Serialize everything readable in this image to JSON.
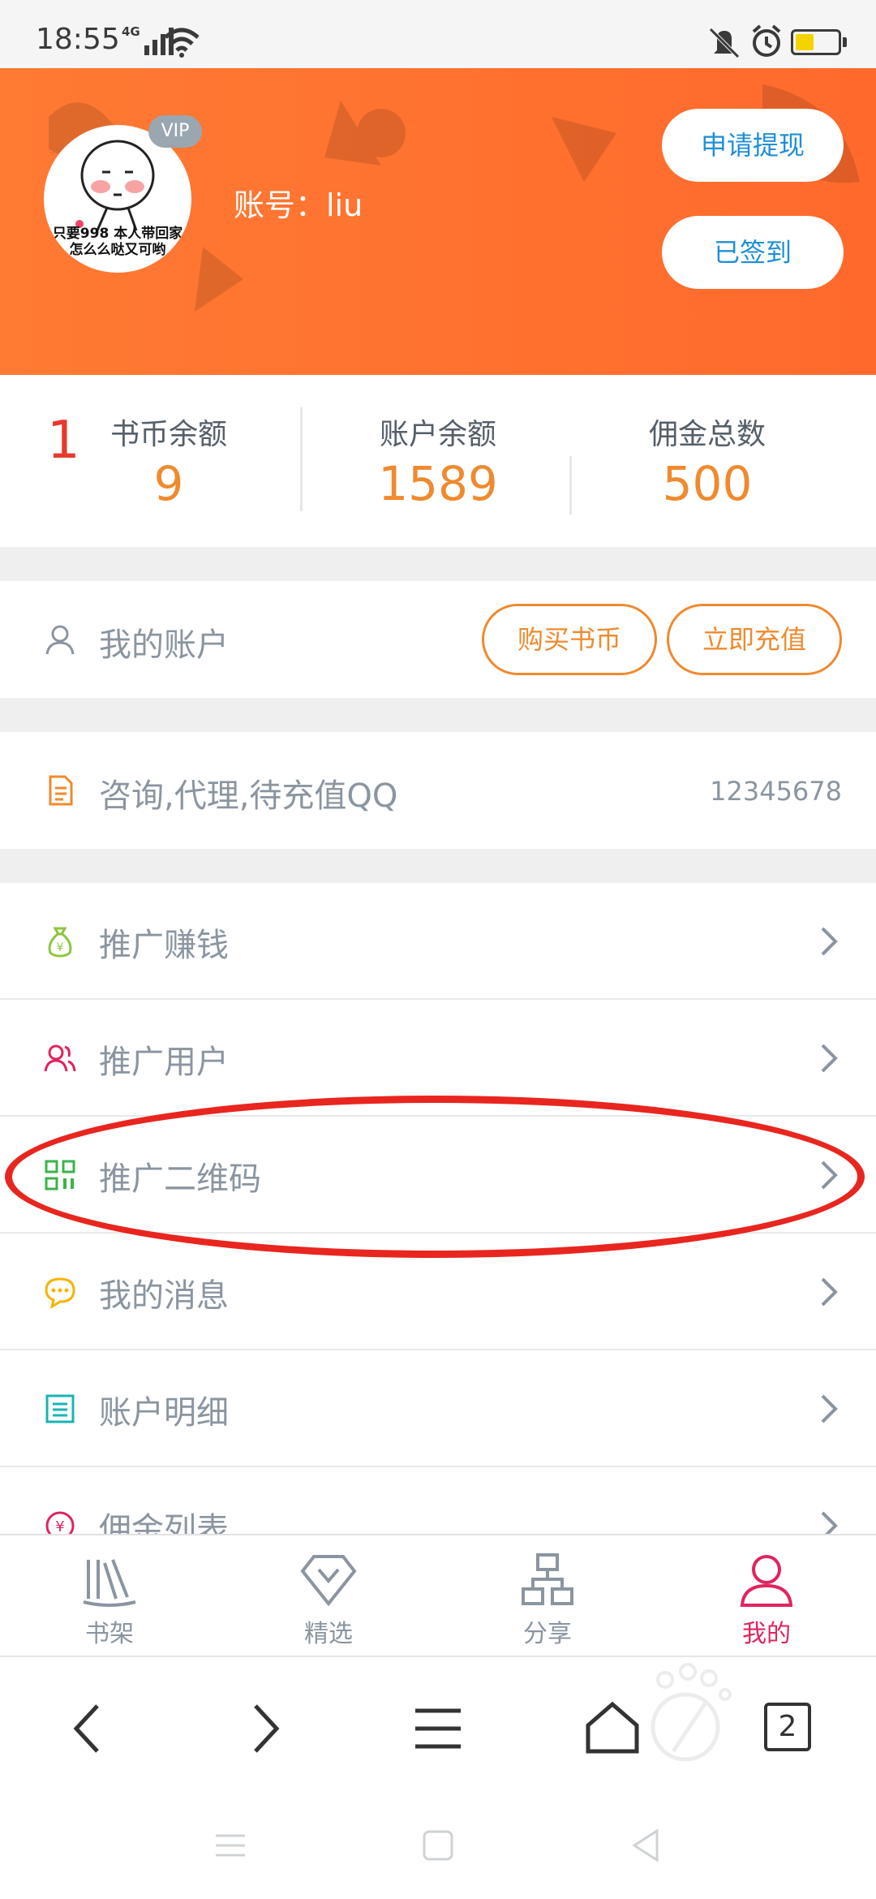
{
  "status_bar": {
    "time": "18:55",
    "network": "4G"
  },
  "header": {
    "vip_badge": "VIP",
    "avatar_caption": "只要998 本人带回家\n怎么么哒又可哟",
    "account_label": "账号：liu",
    "withdraw_button": "申请提现",
    "signed_button": "已签到"
  },
  "stats": {
    "count": "1",
    "items": [
      {
        "label": "书币余额",
        "value": "9"
      },
      {
        "label": "账户余额",
        "value": "1589"
      },
      {
        "label": "佣金总数",
        "value": "500"
      }
    ]
  },
  "my_account": {
    "label": "我的账户",
    "buy_coins": "购买书币",
    "recharge_now": "立即充值"
  },
  "contact": {
    "label": "咨询,代理,待充值QQ",
    "qq": "12345678"
  },
  "menu": [
    {
      "label": "推广赚钱",
      "icon": "money-bag-icon",
      "color": "#8cc63f"
    },
    {
      "label": "推广用户",
      "icon": "users-icon",
      "color": "#e0245e"
    },
    {
      "label": "推广二维码",
      "icon": "qrcode-icon",
      "color": "#3bb34a"
    },
    {
      "label": "我的消息",
      "icon": "message-icon",
      "color": "#f4b400"
    },
    {
      "label": "账户明细",
      "icon": "list-icon",
      "color": "#19b4b4"
    },
    {
      "label": "佣金列表",
      "icon": "yen-icon",
      "color": "#e0245e"
    }
  ],
  "tabbar": [
    {
      "label": "书架",
      "icon": "bookshelf-icon"
    },
    {
      "label": "精选",
      "icon": "featured-icon"
    },
    {
      "label": "分享",
      "icon": "share-icon"
    },
    {
      "label": "我的",
      "icon": "profile-icon",
      "active": true
    }
  ],
  "browser": {
    "tab_count": "2"
  },
  "colors": {
    "header_orange": "#ff6a2c",
    "accent_orange": "#ef8a2e",
    "link_blue": "#1e8fd5",
    "active_pink": "#e0245e",
    "highlight_red": "#e8261f"
  }
}
